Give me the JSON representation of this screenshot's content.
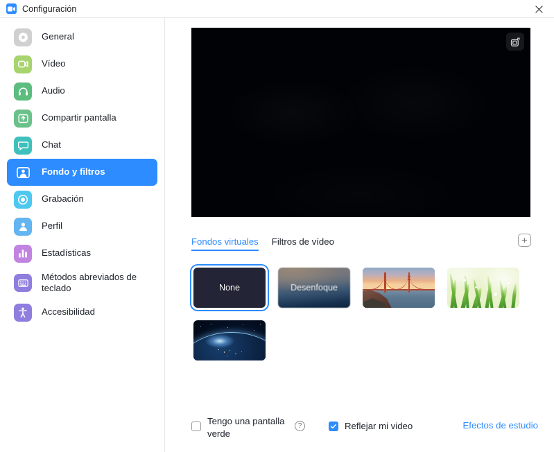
{
  "window": {
    "title": "Configuración",
    "app_icon": "zoom-video-icon",
    "close_icon": "close-icon",
    "brand_color": "#2d8cff"
  },
  "sidebar": {
    "items": [
      {
        "label": "General",
        "icon": "gear-icon",
        "icon_color": "#d0d0d0",
        "key": "general",
        "active": false,
        "tall": false
      },
      {
        "label": "Vídeo",
        "icon": "video-icon",
        "icon_color": "#a8d46f",
        "key": "video",
        "active": false,
        "tall": false
      },
      {
        "label": "Audio",
        "icon": "headphones-icon",
        "icon_color": "#5cbd7e",
        "key": "audio",
        "active": false,
        "tall": false
      },
      {
        "label": "Compartir pantalla",
        "icon": "share-screen-icon",
        "icon_color": "#6cc18a",
        "key": "share-screen",
        "active": false,
        "tall": false
      },
      {
        "label": "Chat",
        "icon": "chat-icon",
        "icon_color": "#3fc0bd",
        "key": "chat",
        "active": false,
        "tall": false
      },
      {
        "label": "Fondo y filtros",
        "icon": "person-card-icon",
        "icon_color": "#2d8cff",
        "key": "background",
        "active": true,
        "tall": false
      },
      {
        "label": "Grabación",
        "icon": "record-icon",
        "icon_color": "#4ec8f0",
        "key": "recording",
        "active": false,
        "tall": false
      },
      {
        "label": "Perfil",
        "icon": "profile-icon",
        "icon_color": "#62b5f0",
        "key": "profile",
        "active": false,
        "tall": false
      },
      {
        "label": "Estadísticas",
        "icon": "bar-chart-icon",
        "icon_color": "#c184e0",
        "key": "statistics",
        "active": false,
        "tall": false
      },
      {
        "label": "Métodos abreviados de teclado",
        "icon": "keyboard-icon",
        "icon_color": "#8f7ede",
        "key": "shortcuts",
        "active": false,
        "tall": true
      },
      {
        "label": "Accesibilidad",
        "icon": "accessibility-icon",
        "icon_color": "#8f7ede",
        "key": "accessibility",
        "active": false,
        "tall": false
      }
    ]
  },
  "preview": {
    "name": "video-preview",
    "snapshot_icon": "camera-icon",
    "state": "camera-off-black"
  },
  "tabs": [
    {
      "label": "Fondos virtuales",
      "key": "virtual-backgrounds",
      "active": true
    },
    {
      "label": "Filtros de vídeo",
      "key": "video-filters",
      "active": false
    }
  ],
  "add_button": {
    "icon": "plus-icon",
    "tooltip_label": "+"
  },
  "backgrounds": [
    {
      "label": "None",
      "key": "none",
      "kind": "none",
      "selected": true
    },
    {
      "label": "Desenfoque",
      "key": "blur",
      "kind": "blur",
      "selected": false
    },
    {
      "label": "",
      "key": "golden-gate",
      "kind": "bridge",
      "selected": false
    },
    {
      "label": "",
      "key": "grass",
      "kind": "grass",
      "selected": false
    },
    {
      "label": "",
      "key": "earth",
      "kind": "earth",
      "selected": false
    }
  ],
  "footer": {
    "green_screen_label": "Tengo una pantalla verde",
    "green_screen_checked": false,
    "help_icon": "help-circle-icon",
    "help_glyph": "?",
    "mirror_label": "Reflejar mi video",
    "mirror_checked": true,
    "studio_effects_label": "Efectos de estudio"
  }
}
